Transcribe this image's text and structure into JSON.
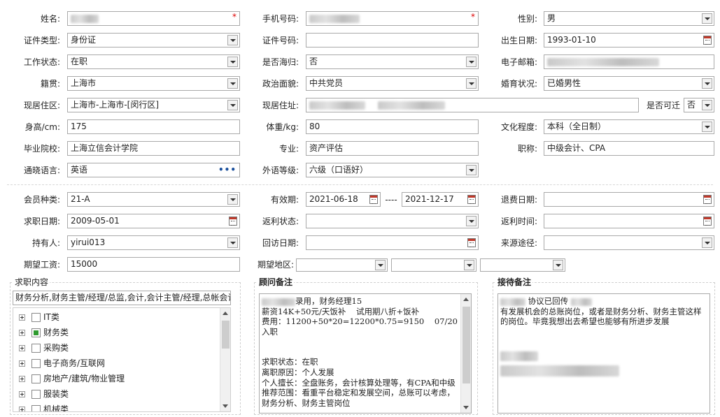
{
  "personal": {
    "name_label": "姓名:",
    "mobile_label": "手机号码:",
    "gender_label": "性别:",
    "gender_value": "男",
    "id_type_label": "证件类型:",
    "id_type_value": "身份证",
    "id_number_label": "证件号码:",
    "birth_label": "出生日期:",
    "birth_value": "1993-01-10",
    "work_status_label": "工作状态:",
    "work_status_value": "在职",
    "returnee_label": "是否海归:",
    "returnee_value": "否",
    "email_label": "电子邮箱:",
    "native_label": "籍贯:",
    "native_value": "上海市",
    "political_label": "政治面貌:",
    "political_value": "中共党员",
    "marital_label": "婚育状况:",
    "marital_value": "已婚男性",
    "residence_area_label": "现居住区:",
    "residence_area_value": "上海市-上海市-[闵行区]",
    "residence_addr_label": "现居住址:",
    "relocate_label": "是否可迁",
    "relocate_value": "否",
    "height_label": "身高/cm:",
    "height_value": "175",
    "weight_label": "体重/kg:",
    "weight_value": "80",
    "education_label": "文化程度:",
    "education_value": "本科（全日制）",
    "school_label": "毕业院校:",
    "school_value": "上海立信会计学院",
    "major_label": "专业:",
    "major_value": "资产评估",
    "title_label": "职称:",
    "title_value": "中级会计、CPA",
    "language_label": "通晓语言:",
    "language_value": "英语",
    "foreign_level_label": "外语等级:",
    "foreign_level_value": "六级（口语好）"
  },
  "membership": {
    "member_type_label": "会员种类:",
    "member_type_value": "21-A",
    "valid_label": "有效期:",
    "valid_from": "2021-06-18",
    "valid_sep": "----",
    "valid_to": "2021-12-17",
    "refund_date_label": "退费日期:",
    "apply_date_label": "求职日期:",
    "apply_date_value": "2009-05-01",
    "rebate_status_label": "返利状态:",
    "rebate_time_label": "返利时间:",
    "holder_label": "持有人:",
    "holder_value": "yirui013",
    "visit_date_label": "回访日期:",
    "source_label": "来源途径:",
    "salary_label": "期望工资:",
    "salary_value": "15000",
    "region_label": "期望地区:"
  },
  "job_content": {
    "title": "求职内容",
    "summary": "财务分析,财务主管/经理/总监,会计,会计主管/经理,总帐会计",
    "categories": [
      {
        "label": "IT类",
        "checked": false
      },
      {
        "label": "财务类",
        "checked": true
      },
      {
        "label": "采购类",
        "checked": false
      },
      {
        "label": "电子商务/互联网",
        "checked": false
      },
      {
        "label": "房地产/建筑/物业管理",
        "checked": false
      },
      {
        "label": "服装类",
        "checked": false
      },
      {
        "label": "机械类",
        "checked": false
      }
    ]
  },
  "consultant_notes": {
    "title": "顾问备注",
    "line1": "录用，财务经理15",
    "line2": "薪资14K+50元/天饭补    试用期八折+饭补",
    "line3": "费用：11200+50*20=12200*0.75=9150    07/20入职",
    "line4": "求职状态：在职",
    "line5": "离职原因：个人发展",
    "line6": "个人擅长：全盘账务，会计核算处理等，有CPA和中级",
    "line7": "推荐范围：看重平台稳定和发展空间，总账可以考虑，财务分析、财务主管岗位"
  },
  "reception_notes": {
    "title": "接待备注",
    "line1": "协议已回传",
    "line2": "有发展机会的总账岗位，或者是财务分析、财务主管这样的岗位。毕竟我想出去希望也能够有所进步发展"
  },
  "icons": {
    "dropdown": "chevron-down-icon",
    "calendar": "calendar-icon",
    "ellipsis": "more-icon",
    "tree_toggle": "plus-icon"
  }
}
